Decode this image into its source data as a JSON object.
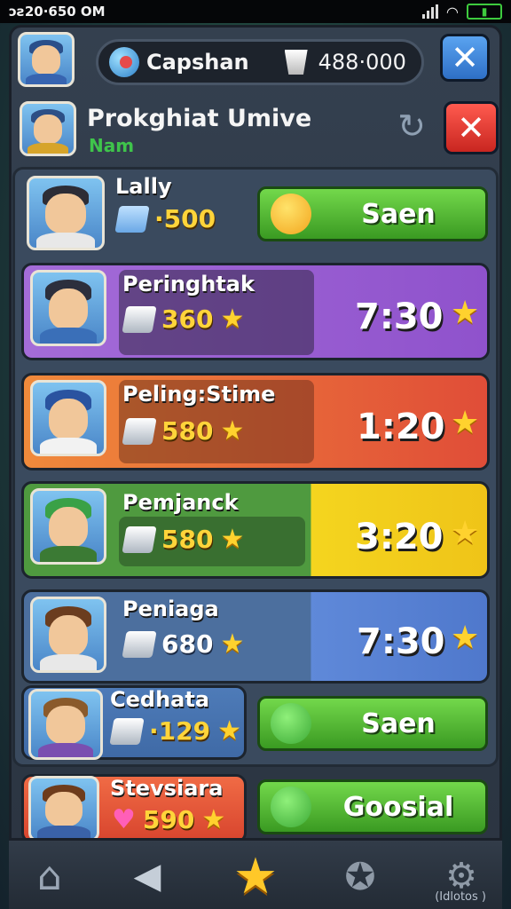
{
  "status_bar": {
    "time": "ɔƨ20·650 OM"
  },
  "top_bar": {
    "currency_label": "Capshan",
    "currency_value": "488·000"
  },
  "header": {
    "title": "Prokghiat Umive",
    "subtitle": "Nam"
  },
  "rows": [
    {
      "name": "Lally",
      "value": "·500",
      "button_label": "Saen"
    },
    {
      "name": "Peringhtak",
      "value": "360",
      "time": "7:30"
    },
    {
      "name": "Peling:Stime",
      "value": "580",
      "time": "1:20"
    },
    {
      "name": "Pemjanck",
      "value": "580",
      "time": "3:20"
    },
    {
      "name": "Peniaga",
      "value": "680",
      "time": "7:30"
    },
    {
      "name": "Cedhata",
      "value": "·129",
      "button_label": "Saen"
    },
    {
      "name": "Stevsiara",
      "value": "590",
      "button_label": "Goosial"
    }
  ],
  "bottom_nav": {
    "last_label": "(Idlotos )"
  },
  "colors": {
    "green_button": "#4cb82f",
    "purple_row": "#9b5ed4",
    "red_row": "#e4503a",
    "yellow_row": "#f1d21e",
    "blue_row": "#5c86d8",
    "close_red": "#e0352f",
    "close_blue": "#3f8be0"
  },
  "icons": [
    "search-icon",
    "refresh-icon",
    "close-icon",
    "home-icon",
    "back-icon",
    "star-icon",
    "badge-icon",
    "gear-icon"
  ]
}
